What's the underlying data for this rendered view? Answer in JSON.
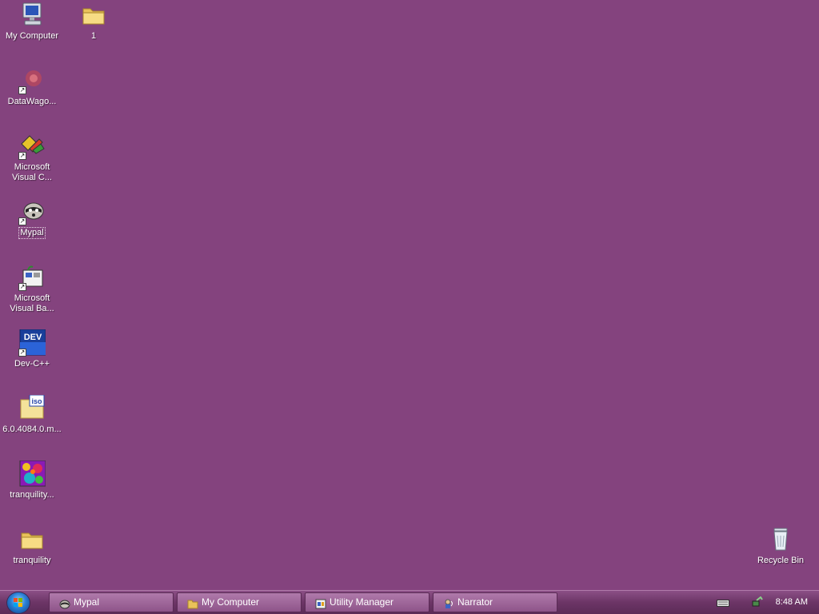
{
  "desktop": {
    "icons": [
      {
        "label": "My Computer",
        "icon": "computer-icon"
      },
      {
        "label": "1",
        "icon": "folder-icon"
      },
      {
        "label": "DataWago...",
        "icon": "datawagon-icon"
      },
      {
        "label": "Microsoft Visual C...",
        "icon": "visual-cpp-icon"
      },
      {
        "label": "Mypal",
        "icon": "mypal-icon"
      },
      {
        "label": "Microsoft Visual Ba...",
        "icon": "visual-basic-icon"
      },
      {
        "label": "Dev-C++",
        "icon": "devcpp-icon"
      },
      {
        "label": "6.0.4084.0.m...",
        "icon": "iso-file-icon"
      },
      {
        "label": "tranquility...",
        "icon": "image-file-icon"
      },
      {
        "label": "tranquility",
        "icon": "folder-icon"
      },
      {
        "label": "Recycle Bin",
        "icon": "recycle-bin-icon"
      }
    ],
    "devcpp_icon_text": "DEV",
    "iso_icon_text": "iso"
  },
  "taskbar": {
    "start_icon": "windows-start-orb",
    "buttons": [
      {
        "label": "Mypal",
        "icon": "mypal-icon"
      },
      {
        "label": "My Computer",
        "icon": "folder-icon"
      },
      {
        "label": "Utility Manager",
        "icon": "utility-manager-icon"
      },
      {
        "label": "Narrator",
        "icon": "narrator-icon"
      }
    ],
    "tray": {
      "icons": [
        "keyboard-icon",
        "network-icon"
      ],
      "clock": "8:48 AM"
    }
  },
  "colors": {
    "desktop_background": "#84437e",
    "taskbar": "#6c3566"
  }
}
